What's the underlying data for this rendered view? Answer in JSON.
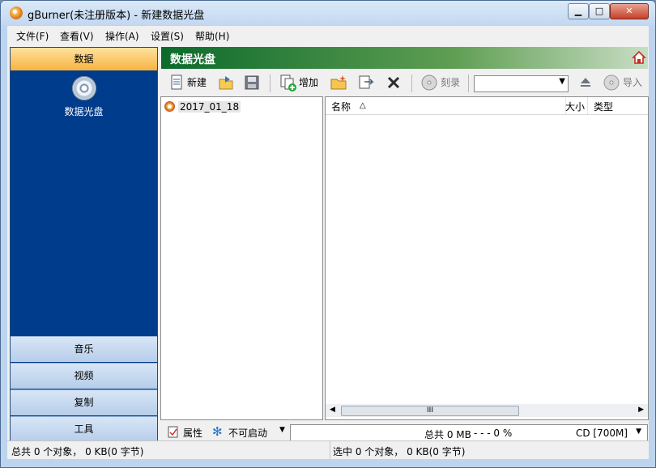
{
  "window": {
    "title": "gBurner(未注册版本) - 新建数据光盘"
  },
  "menu": [
    "文件(F)",
    "查看(V)",
    "操作(A)",
    "设置(S)",
    "帮助(H)"
  ],
  "sidebar": {
    "active": "数据",
    "disc": "数据光盘",
    "items": [
      "音乐",
      "视频",
      "复制",
      "工具"
    ]
  },
  "main": {
    "title": "数据光盘"
  },
  "toolbar": {
    "new": "新建",
    "add": "增加",
    "burn": "刻录",
    "import": "导入",
    "combo": ""
  },
  "tree": {
    "item": "2017_01_18"
  },
  "list": {
    "columns": [
      "名称",
      "大小",
      "类型"
    ],
    "scroll_text": "III"
  },
  "bottom": {
    "properties": "属性",
    "boot": "不可启动",
    "total": "总共 0 MB",
    "percent": "- - - 0 %",
    "capacity": "CD [700M]"
  },
  "status": {
    "left": "总共 0 个对象， 0 KB(0 字节)",
    "right": "选中 0 个对象， 0 KB(0 字节)"
  }
}
